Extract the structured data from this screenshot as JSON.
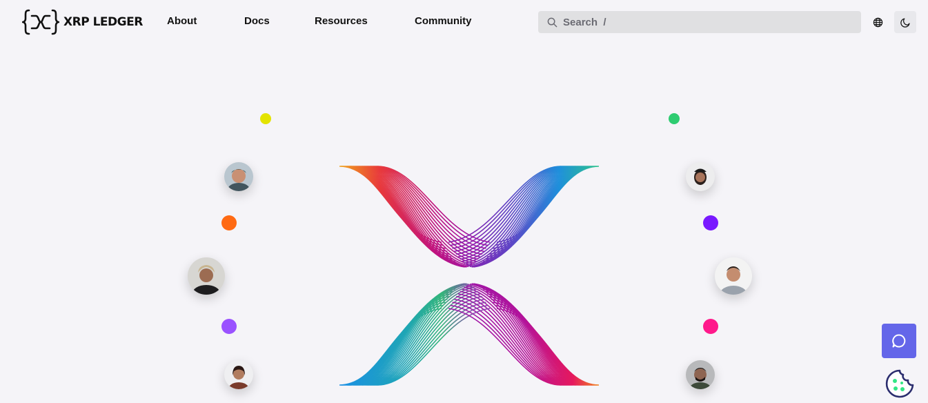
{
  "brand": {
    "name": "XRP LEDGER",
    "logo_icon": "xrp-logo-icon"
  },
  "nav": {
    "items": [
      {
        "label": "About"
      },
      {
        "label": "Docs"
      },
      {
        "label": "Resources"
      },
      {
        "label": "Community"
      }
    ]
  },
  "search": {
    "placeholder": "Search  /",
    "icon": "search-icon"
  },
  "toolbar": {
    "language_icon": "globe-icon",
    "theme_icon": "moon-icon"
  },
  "hero": {
    "dots": [
      {
        "name": "yellow-dot",
        "color": "#e3e300"
      },
      {
        "name": "green-dot",
        "color": "#2ecc71"
      },
      {
        "name": "orange-dot",
        "color": "#ff6a13"
      },
      {
        "name": "violet-dot",
        "color": "#7919ff"
      },
      {
        "name": "purple-dot",
        "color": "#9a52ff"
      },
      {
        "name": "pink-dot",
        "color": "#ff198b"
      }
    ],
    "avatars": [
      "community-avatar-1",
      "community-avatar-2",
      "community-avatar-3",
      "community-avatar-4",
      "community-avatar-5",
      "community-avatar-6"
    ]
  },
  "floating": {
    "chat_icon": "chat-bubble-icon",
    "cookie_icon": "cookie-icon"
  },
  "colors": {
    "accent": "#6466e9",
    "background": "#f5f4f8",
    "cookie_green": "#32e685",
    "cookie_navy": "#2b2d6e"
  }
}
